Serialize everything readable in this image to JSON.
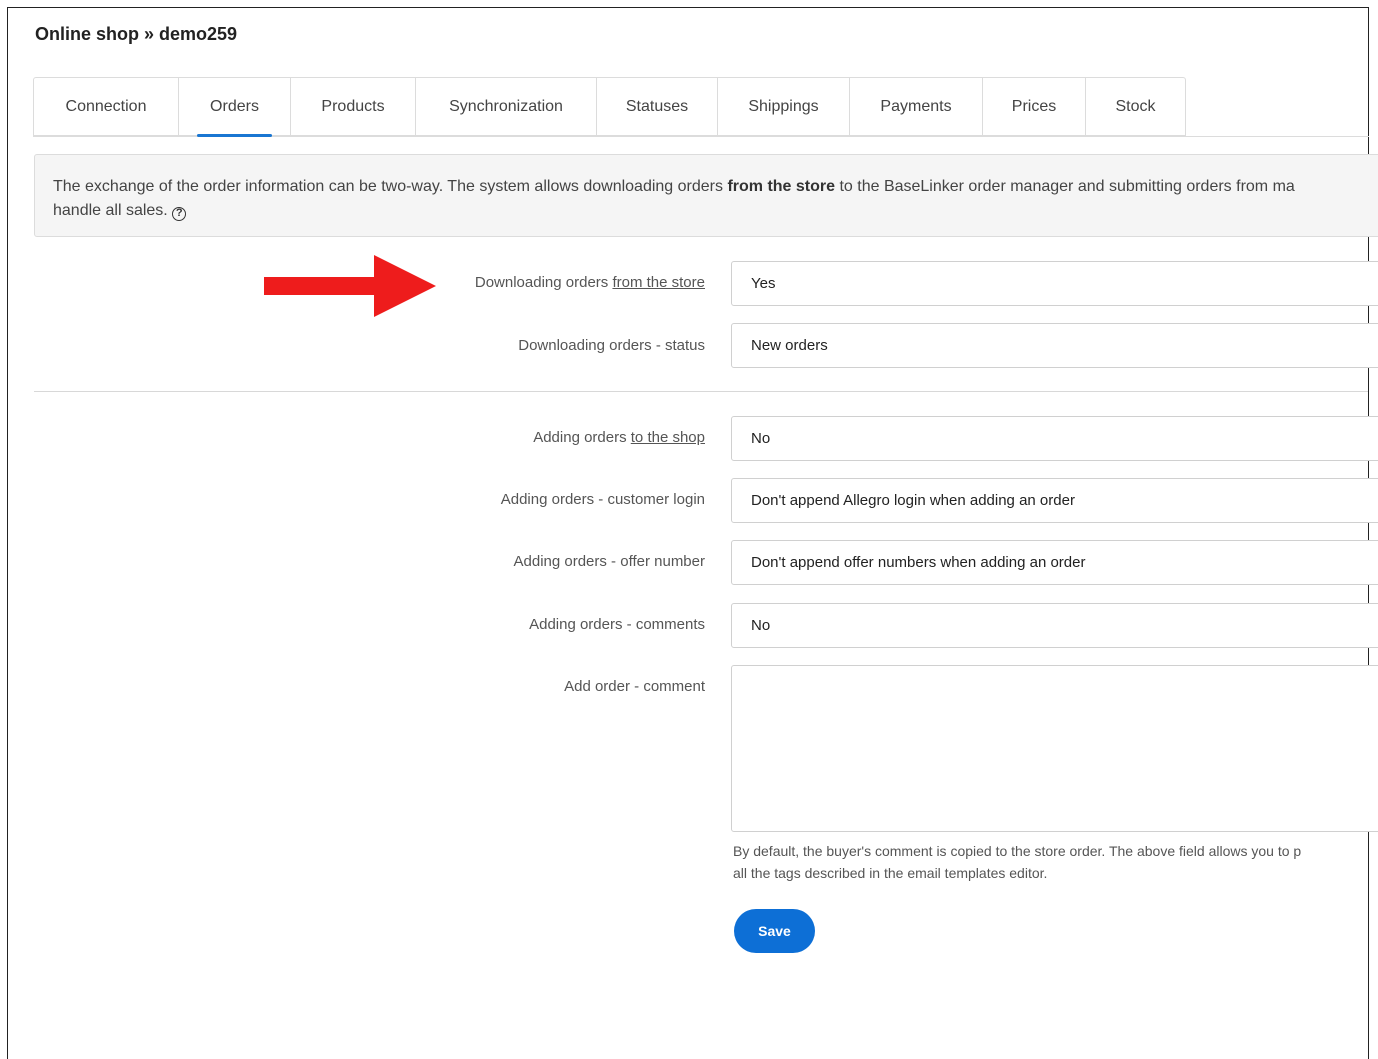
{
  "header": {
    "title": "Online shop » demo259"
  },
  "tabs": [
    {
      "label": "Connection"
    },
    {
      "label": "Orders",
      "active": true
    },
    {
      "label": "Products"
    },
    {
      "label": "Synchronization"
    },
    {
      "label": "Statuses"
    },
    {
      "label": "Shippings"
    },
    {
      "label": "Payments"
    },
    {
      "label": "Prices"
    },
    {
      "label": "Stock"
    }
  ],
  "info": {
    "line1_before": "The exchange of the order information can be two-way. The system allows downloading orders ",
    "line1_bold": "from the store",
    "line1_after": " to the BaseLinker order manager and submitting orders from ma",
    "line2": "handle all sales. ",
    "help_icon": "question-circle-icon"
  },
  "form": {
    "download_orders": {
      "label_prefix": "Downloading orders ",
      "label_link": "from the store",
      "value": "Yes"
    },
    "download_status": {
      "label": "Downloading orders - status",
      "value": "New orders"
    },
    "adding_orders": {
      "label_prefix": "Adding orders ",
      "label_link": "to the shop",
      "value": "No"
    },
    "customer_login": {
      "label": "Adding orders - customer login",
      "value": "Don't append Allegro login when adding an order"
    },
    "offer_number": {
      "label": "Adding orders - offer number",
      "value": "Don't append offer numbers when adding an order"
    },
    "comments": {
      "label": "Adding orders - comments",
      "value": "No"
    },
    "add_comment": {
      "label": "Add order - comment",
      "value": ""
    }
  },
  "hint": {
    "line1": "By default, the buyer's comment is copied to the store order. The above field allows you to p",
    "line2": "all the tags described in the email templates editor."
  },
  "actions": {
    "save_label": "Save"
  },
  "annotation": {
    "arrow_color": "#ee1c1c"
  },
  "colors": {
    "accent": "#0d6fd6",
    "tab_indicator": "#1976d2"
  }
}
